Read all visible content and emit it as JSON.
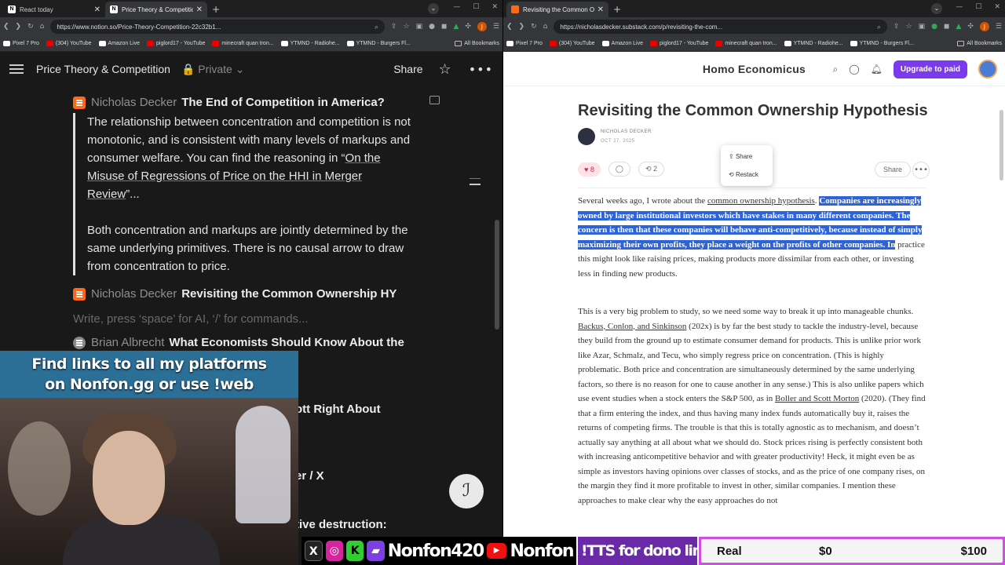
{
  "left_browser": {
    "tabs": [
      {
        "label": "React today",
        "favicon": "N",
        "active": false
      },
      {
        "label": "Price Theory & Competition",
        "favicon": "N",
        "active": true
      }
    ],
    "url": "https://www.notion.so/Price-Theory-Competition-22c32b1...",
    "bookmarks": [
      "Pixel 7 Pro",
      "(304) YouTube",
      "Amazon Live",
      "piglord17 - YouTube",
      "minecraft quan tron...",
      "YTMND - Radiohe...",
      "YTMND - Burgers Fl...",
      "All Bookmarks"
    ]
  },
  "notion": {
    "page_title": "Price Theory & Competition",
    "privacy": "Private",
    "share_label": "Share",
    "entries": [
      {
        "author": "Nicholas Decker",
        "title": "The End of Competition in America?"
      },
      {
        "author": "Nicholas Decker",
        "title": "Revisiting the Common Ownership HY"
      },
      {
        "author": "Brian Albrecht",
        "title": "What Economists Should Know About the"
      }
    ],
    "quote_p1_before": "The relationship between concentration and competition is not monotonic, and is consistent with many levels of markups and consumer welfare. You can find the reasoning in “",
    "quote_p1_link": "On the Misuse of Regressions of Price on the HHI in Merger Review",
    "quote_p1_after": "”...",
    "quote_p2": "Both concentration and markups are jointly determined by the same underlying primitives. There is no causal arrow to draw from concentration to price.",
    "placeholder": "Write, press ‘space’ for AI, ‘/’ for commands...",
    "partial_lines": [
      "ott Right About",
      "er / X",
      "tive destruction:"
    ]
  },
  "right_browser": {
    "tabs": [
      {
        "label": "Revisiting the Common Owner",
        "active": true
      }
    ],
    "url": "https://nicholasdecker.substack.com/p/revisiting-the-com...",
    "bookmarks": [
      "Pixel 7 Pro",
      "(304) YouTube",
      "Amazon Live",
      "piglord17 - YouTube",
      "minecraft quan tron...",
      "YTMND - Radiohe...",
      "YTMND - Burgers Fl...",
      "All Bookmarks"
    ]
  },
  "substack": {
    "publication": "Homo Economicus",
    "upgrade_label": "Upgrade to paid",
    "title": "Revisiting the Common Ownership Hypothesis",
    "author": "NICHOLAS DECKER",
    "date": "OCT 27, 2025",
    "likes": "8",
    "restacks": "2",
    "share_label": "Share",
    "popover": {
      "share": "Share",
      "restack": "Restack"
    },
    "p1_before": "Several weeks ago, I wrote about the ",
    "p1_link": "common ownership hypothesis",
    "p1_mid": ". ",
    "p1_selected": "Companies are increasingly owned by large institutional investors which have stakes in many different companies. The concern is then that these companies will behave anti-competitively, because instead of simply maximizing their own profits, they place a weight on the profits of other companies. In",
    "p1_after": " practice this might look like raising prices, making products more dissimilar from each other, or investing less in finding new products.",
    "p2_a": "This is a very big problem to study, so we need some way to break it up into manageable chunks. ",
    "p2_link1": "Backus, Conlon, and Sinkinson",
    "p2_b": " (202x) is by far the best study to tackle the industry-level, because they build from the ground up to estimate consumer demand for products. This is unlike prior work like Azar, Schmalz, and Tecu, who simply regress price on concentration. (This is highly problematic. Both price and concentration are simultaneously determined by the same underlying factors, so there is no reason for one to cause another in any sense.) This is also unlike papers which use event studies when a stock enters the S&P 500, as in ",
    "p2_link2": "Boller and Scott Morton",
    "p2_c": " (2020). (They find that a firm entering the index, and thus having many index funds automatically buy it, raises the returns of competing firms. The trouble is that this is totally agnostic as to mechanism, and doesn’t actually say anything at all about what we should do. Stock prices rising is perfectly consistent both with increasing anticompetitive behavior and with greater productivity! Heck, it might even be as simple as investors having opinions over classes of stocks, and as the price of one company rises, on the margin they find it more profitable to invest in other, similar companies. I mention these approaches to make clear why the easy approaches do not"
  },
  "stream": {
    "banner_line1": "Find links to all my platforms",
    "banner_line2": "on Nonfon.gg or use !web",
    "handle1": "Nonfon420",
    "handle2": "Nonfon",
    "tts": "!TTS for dono link",
    "goal_label": "Real",
    "goal_current": "$0",
    "goal_target": "$100"
  }
}
